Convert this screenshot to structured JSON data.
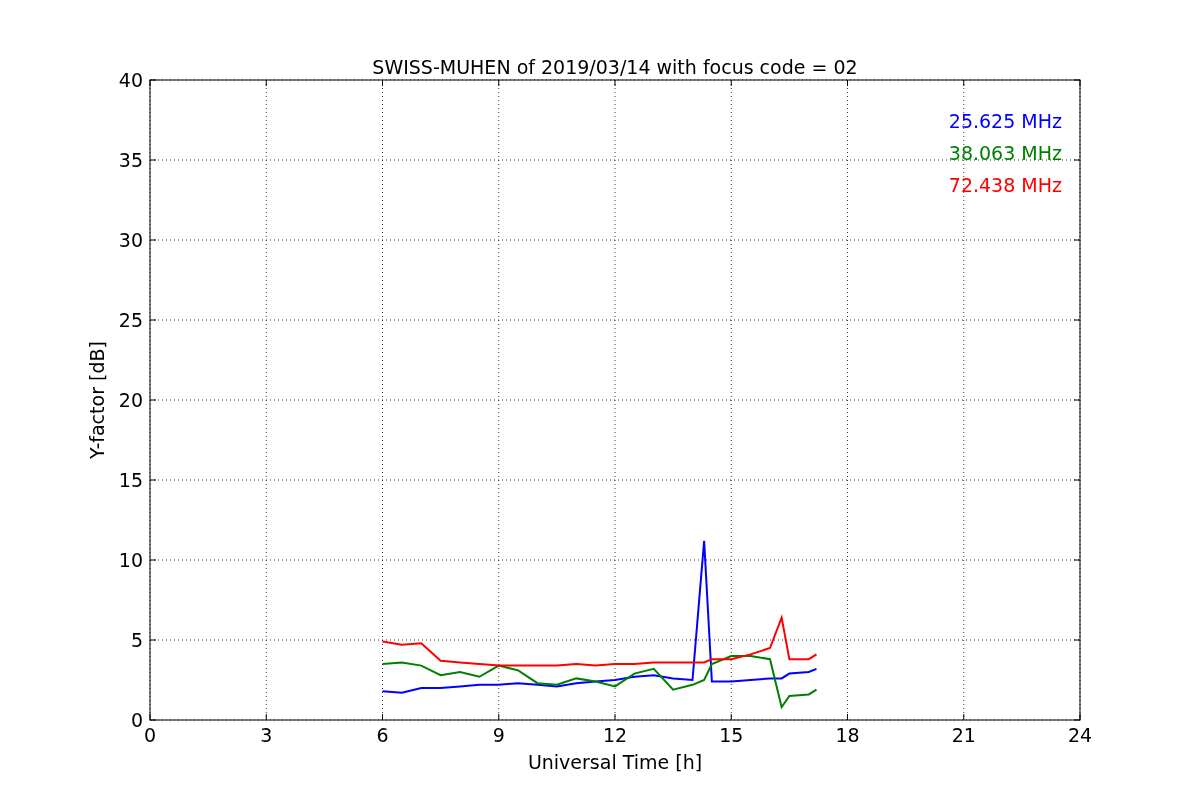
{
  "chart_data": {
    "type": "line",
    "title": "SWISS-MUHEN of 2019/03/14 with focus code = 02",
    "xlabel": "Universal Time [h]",
    "ylabel": "Y-factor [dB]",
    "x": [
      6,
      6.5,
      7,
      7.5,
      8,
      8.5,
      9,
      9.5,
      10,
      10.5,
      11,
      11.5,
      12,
      12.5,
      13,
      13.5,
      14,
      14.3,
      14.5,
      15,
      15.5,
      16,
      16.3,
      16.5,
      17,
      17.2
    ],
    "series": [
      {
        "name": "25.625 MHz",
        "color": "#0000ff",
        "values": [
          1.8,
          1.7,
          2.0,
          2.0,
          2.1,
          2.2,
          2.2,
          2.3,
          2.2,
          2.1,
          2.3,
          2.4,
          2.5,
          2.7,
          2.8,
          2.6,
          2.5,
          11.2,
          2.4,
          2.4,
          2.5,
          2.6,
          2.6,
          2.9,
          3.0,
          3.2
        ]
      },
      {
        "name": "38.063 MHz",
        "color": "#008000",
        "values": [
          3.5,
          3.6,
          3.4,
          2.8,
          3.0,
          2.7,
          3.4,
          3.1,
          2.3,
          2.2,
          2.6,
          2.4,
          2.1,
          2.9,
          3.2,
          1.9,
          2.2,
          2.5,
          3.5,
          4.0,
          4.0,
          3.8,
          0.8,
          1.5,
          1.6,
          1.9
        ]
      },
      {
        "name": "72.438 MHz",
        "color": "#ff0000",
        "values": [
          4.9,
          4.7,
          4.8,
          3.7,
          3.6,
          3.5,
          3.4,
          3.4,
          3.4,
          3.4,
          3.5,
          3.4,
          3.5,
          3.5,
          3.6,
          3.6,
          3.6,
          3.6,
          3.8,
          3.8,
          4.1,
          4.5,
          6.4,
          3.8,
          3.8,
          4.1
        ]
      }
    ],
    "xlim": [
      0,
      24
    ],
    "ylim": [
      0,
      40
    ],
    "grid": true,
    "xticks": [
      0,
      3,
      6,
      9,
      12,
      15,
      18,
      21,
      24
    ],
    "yticks": [
      0,
      5,
      10,
      15,
      20,
      25,
      30,
      35,
      40
    ]
  }
}
